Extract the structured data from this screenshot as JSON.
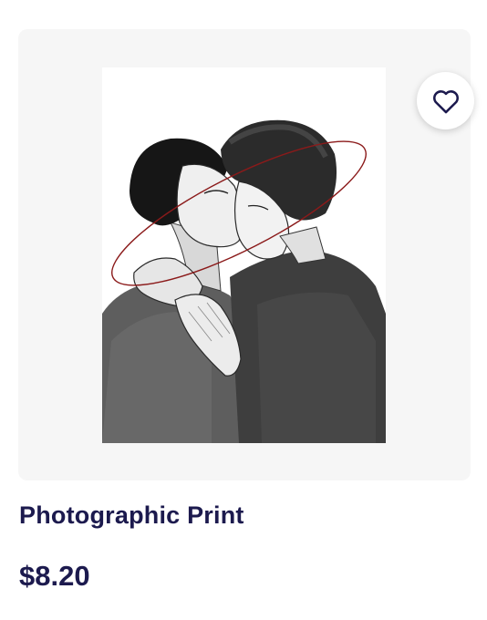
{
  "product": {
    "title": "Photographic Print",
    "price": "$8.20",
    "favorite_icon": "heart-outline-icon",
    "image_icon": "artwork-illustration",
    "colors": {
      "text": "#1c1a4e",
      "panel_background": "#f6f6f6",
      "accent_line": "#8b1a1a"
    }
  }
}
